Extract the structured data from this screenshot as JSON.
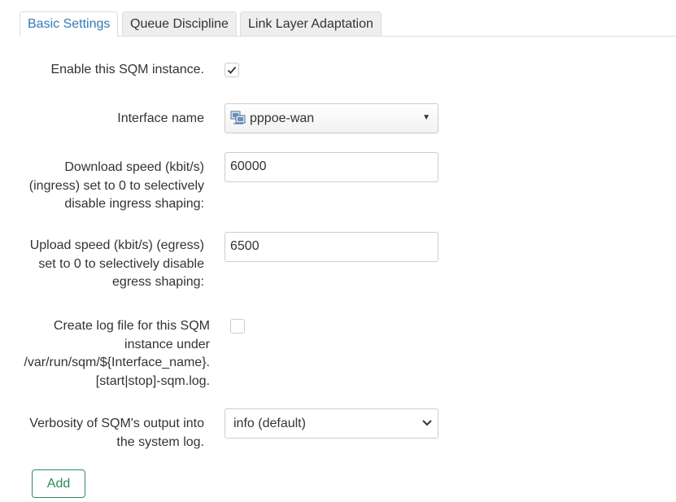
{
  "tabs": [
    {
      "label": "Basic Settings",
      "active": true
    },
    {
      "label": "Queue Discipline",
      "active": false
    },
    {
      "label": "Link Layer Adaptation",
      "active": false
    }
  ],
  "form": {
    "enable": {
      "label": "Enable this SQM instance.",
      "checked": true
    },
    "interface": {
      "label": "Interface name",
      "value": "pppoe-wan",
      "icon": "network-interface-icon"
    },
    "download": {
      "label_lines": [
        "Download speed (kbit/s)",
        "(ingress) set to 0 to selectively",
        "disable ingress shaping:"
      ],
      "value": "60000"
    },
    "upload": {
      "label_lines": [
        "Upload speed (kbit/s) (egress)",
        "set to 0 to selectively disable",
        "egress shaping:"
      ],
      "value": "6500"
    },
    "logfile": {
      "label_lines": [
        "Create log file for this SQM",
        "instance under",
        "/var/run/sqm/${Interface_name}.",
        "[start|stop]-sqm.log."
      ],
      "checked": false
    },
    "verbosity": {
      "label_lines": [
        "Verbosity of SQM's output into",
        "the system log."
      ],
      "value": "info (default)"
    }
  },
  "actions": {
    "add_label": "Add"
  },
  "colors": {
    "tab_active_text": "#337ab7",
    "add_button": "#2e8b57",
    "border": "#cccccc"
  }
}
